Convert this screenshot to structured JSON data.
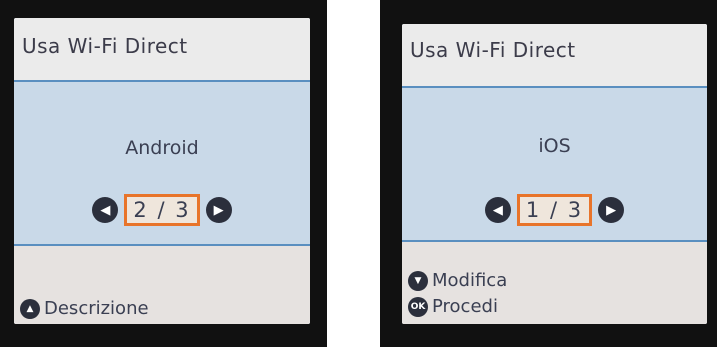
{
  "left_panel": {
    "title": "Usa Wi-Fi Direct",
    "option": "Android",
    "page": "2 / 3",
    "footer": [
      {
        "icon": "up-triangle-icon",
        "label": "Descrizione"
      }
    ]
  },
  "right_panel": {
    "title": "Usa Wi-Fi Direct",
    "option": "iOS",
    "page": "1 / 3",
    "footer": [
      {
        "icon": "down-triangle-icon",
        "label": "Modifica"
      },
      {
        "icon": "ok-icon",
        "label": "Procedi",
        "icon_text": "OK"
      }
    ]
  },
  "colors": {
    "accent": "#e8742a",
    "screen_bg": "#c9d9e8",
    "divider": "#5a8fc0"
  }
}
